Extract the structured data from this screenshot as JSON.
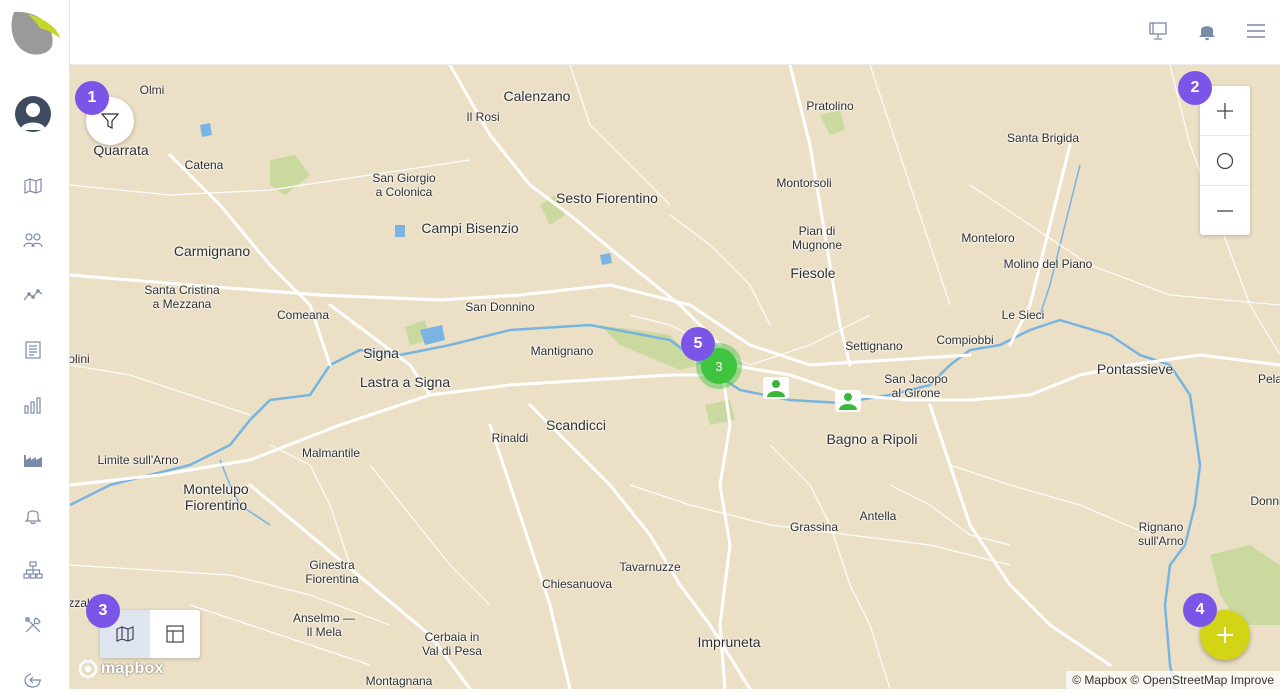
{
  "places": [
    {
      "name": "Olmi",
      "size": "small"
    },
    {
      "name": "Quarrata",
      "size": "big"
    },
    {
      "name": "Calenzano",
      "size": "big"
    },
    {
      "name": "Il Rosi",
      "size": "small"
    },
    {
      "name": "Pratolino",
      "size": "small"
    },
    {
      "name": "Santa Brigida",
      "size": "small"
    },
    {
      "name": "Catena",
      "size": "small"
    },
    {
      "name": "San Giorgio\na Colonica",
      "size": "small"
    },
    {
      "name": "Sesto Fiorentino",
      "size": "big"
    },
    {
      "name": "Montorsoli",
      "size": "small"
    },
    {
      "name": "Campi Bisenzio",
      "size": "big"
    },
    {
      "name": "Pian di\nMugnone",
      "size": "small"
    },
    {
      "name": "Monteloro",
      "size": "small"
    },
    {
      "name": "Carmignano",
      "size": "big"
    },
    {
      "name": "Fiesole",
      "size": "big"
    },
    {
      "name": "Molino del Piano",
      "size": "small"
    },
    {
      "name": "Santa Cristina\na Mezzana",
      "size": "small"
    },
    {
      "name": "San Donnino",
      "size": "small"
    },
    {
      "name": "Le Sieci",
      "size": "small"
    },
    {
      "name": "Comeana",
      "size": "small"
    },
    {
      "name": "Compiobbi",
      "size": "small"
    },
    {
      "name": "Signa",
      "size": "big"
    },
    {
      "name": "Mantignano",
      "size": "small"
    },
    {
      "name": "Settignano",
      "size": "small"
    },
    {
      "name": "Pontassieve",
      "size": "big"
    },
    {
      "name": "olini",
      "size": "small"
    },
    {
      "name": "Lastra a Signa",
      "size": "big"
    },
    {
      "name": "San Jacopo\nal Girone",
      "size": "small"
    },
    {
      "name": "Pela",
      "size": "small"
    },
    {
      "name": "Scandicci",
      "size": "big"
    },
    {
      "name": "Rinaldi",
      "size": "small"
    },
    {
      "name": "Bagno a Ripoli",
      "size": "big"
    },
    {
      "name": "Malmantile",
      "size": "small"
    },
    {
      "name": "Limite sull'Arno",
      "size": "small"
    },
    {
      "name": "Montelupo\nFiorentino",
      "size": "big"
    },
    {
      "name": "Donni",
      "size": "small"
    },
    {
      "name": "Antella",
      "size": "small"
    },
    {
      "name": "Grassina",
      "size": "small"
    },
    {
      "name": "Rignano\nsull'Arno",
      "size": "small"
    },
    {
      "name": "Ginestra\nFiorentina",
      "size": "small"
    },
    {
      "name": "Tavarnuzze",
      "size": "small"
    },
    {
      "name": "Chiesanuova",
      "size": "small"
    },
    {
      "name": "zzal",
      "size": "small"
    },
    {
      "name": "Anselmo —\nIl Mela",
      "size": "small"
    },
    {
      "name": "Impruneta",
      "size": "big"
    },
    {
      "name": "Cerbaia in\nVal di Pesa",
      "size": "small"
    },
    {
      "name": "Montagnana",
      "size": "small"
    }
  ],
  "badges": [
    "1",
    "2",
    "3",
    "4",
    "5"
  ],
  "cluster": {
    "count": "3"
  },
  "mapbox_logo": "mapbox",
  "attribution": "© Mapbox © OpenStreetMap Improve",
  "colors": {
    "accent": "#7b55e8",
    "fab": "#d4d416",
    "cluster": "#3ec43e",
    "map_bg": "#ebdfc5"
  },
  "sidebar_icons": [
    "map-icon",
    "users-icon",
    "trend-icon",
    "report-icon",
    "bar-chart-icon",
    "factory-icon",
    "bell-icon",
    "hierarchy-icon",
    "tools-icon",
    "logout-icon"
  ],
  "top_icons": [
    "presentation-icon",
    "notifications-icon",
    "menu-icon"
  ]
}
